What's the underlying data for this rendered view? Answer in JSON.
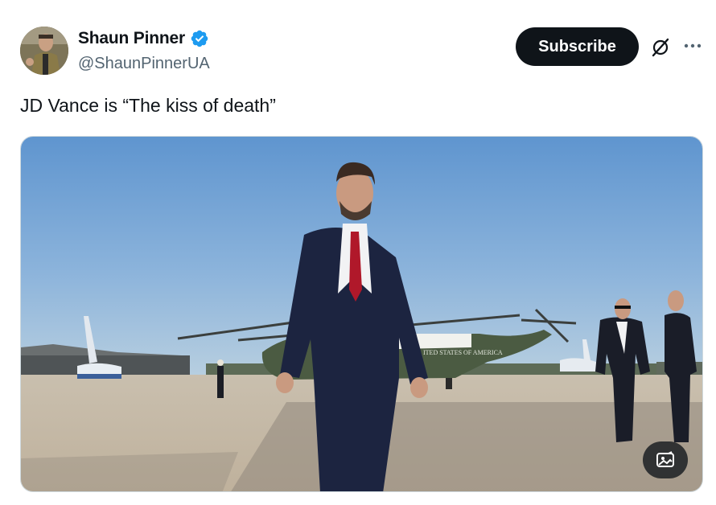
{
  "post": {
    "author": {
      "display_name": "Shaun Pinner",
      "handle": "@ShaunPinnerUA",
      "verified_icon": "verified-badge-icon"
    },
    "actions": {
      "subscribe_label": "Subscribe",
      "grok_icon": "grok-icon",
      "more_icon": "more-options-icon"
    },
    "text": "JD Vance is “The kiss of death”",
    "media": {
      "helicopter_marking": "ITED STATES OF AMERICA",
      "alt_button_icon": "image-alt-icon"
    }
  },
  "colors": {
    "subscribe_bg": "#0f1419",
    "verified_blue": "#1d9bf0",
    "handle_gray": "#536471"
  }
}
